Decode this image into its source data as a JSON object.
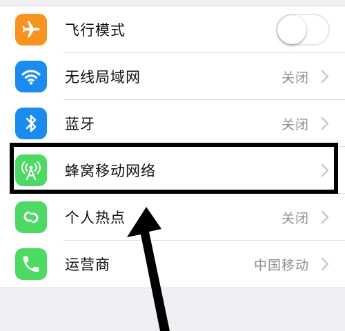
{
  "settings": {
    "rows": [
      {
        "label": "飞行模式",
        "icon": "airplane-icon",
        "icon_color": "#f7931e",
        "control": "toggle",
        "toggle_on": false
      },
      {
        "label": "无线局域网",
        "value": "关闭",
        "icon": "wifi-icon",
        "icon_color": "#1a8cf0",
        "control": "chevron"
      },
      {
        "label": "蓝牙",
        "value": "关闭",
        "icon": "bluetooth-icon",
        "icon_color": "#1a8cf0",
        "control": "chevron"
      },
      {
        "label": "蜂窝移动网络",
        "icon": "cellular-antenna-icon",
        "icon_color": "#4cd964",
        "control": "chevron",
        "highlighted": true
      },
      {
        "label": "个人热点",
        "value": "关闭",
        "icon": "personal-hotspot-icon",
        "icon_color": "#4cd964",
        "control": "chevron"
      },
      {
        "label": "运营商",
        "value": "中国移动",
        "icon": "phone-icon",
        "icon_color": "#4cd964",
        "control": "chevron"
      }
    ]
  },
  "annotation": {
    "box_color": "#000000",
    "arrow_color": "#000000"
  }
}
